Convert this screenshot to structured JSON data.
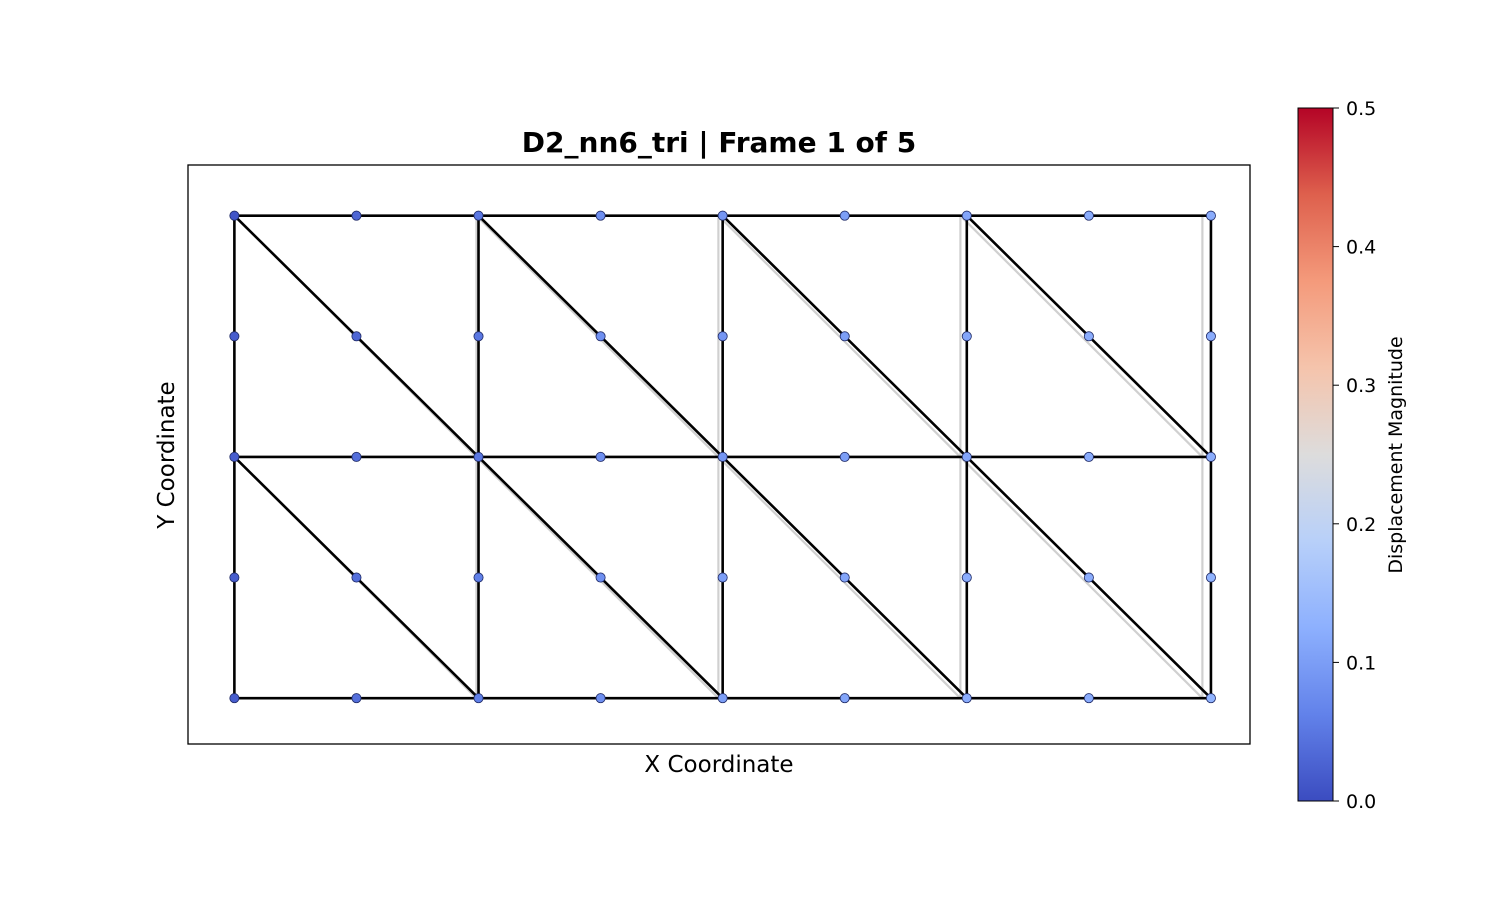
{
  "chart_data": {
    "type": "scatter",
    "title": "D2_nn6_tri  |  Frame 1 of 5",
    "xlabel": "X Coordinate",
    "ylabel": "Y Coordinate",
    "xlim": [
      -0.19,
      4.16
    ],
    "ylim": [
      -0.19,
      2.21
    ],
    "grid": false,
    "colormap": "coolwarm",
    "colorbar": {
      "label": "Displacement Magnitude",
      "range": [
        0.0,
        0.5
      ],
      "ticks": [
        "0.0",
        "0.1",
        "0.2",
        "0.3",
        "0.4",
        "0.5"
      ],
      "stops": [
        "#3b4cc0",
        "#6282ea",
        "#8db0fe",
        "#b8d0f9",
        "#dddcdc",
        "#f5c4ac",
        "#f49a7b",
        "#de604d",
        "#b40426"
      ]
    },
    "mesh": {
      "elements": 16,
      "element_type": "triangle, 6-node",
      "undeformed_edge_color": "#d0d0d0",
      "deformed_edge_color": "#000000",
      "nodes": [
        {
          "x": 0.0,
          "y": 2.0,
          "d": 0.01
        },
        {
          "x": 0.5,
          "y": 2.0,
          "d": 0.03
        },
        {
          "x": 1.0,
          "y": 2.0,
          "d": 0.05
        },
        {
          "x": 1.5,
          "y": 2.0,
          "d": 0.08
        },
        {
          "x": 2.0,
          "y": 2.0,
          "d": 0.09
        },
        {
          "x": 2.5,
          "y": 2.0,
          "d": 0.1
        },
        {
          "x": 3.0,
          "y": 2.0,
          "d": 0.11
        },
        {
          "x": 3.5,
          "y": 2.0,
          "d": 0.12
        },
        {
          "x": 4.0,
          "y": 2.0,
          "d": 0.12
        },
        {
          "x": 0.0,
          "y": 1.5,
          "d": 0.02
        },
        {
          "x": 0.5,
          "y": 1.5,
          "d": 0.03
        },
        {
          "x": 1.0,
          "y": 1.5,
          "d": 0.05
        },
        {
          "x": 1.5,
          "y": 1.5,
          "d": 0.08
        },
        {
          "x": 2.0,
          "y": 1.5,
          "d": 0.09
        },
        {
          "x": 2.5,
          "y": 1.5,
          "d": 0.1
        },
        {
          "x": 3.0,
          "y": 1.5,
          "d": 0.11
        },
        {
          "x": 3.5,
          "y": 1.5,
          "d": 0.12
        },
        {
          "x": 4.0,
          "y": 1.5,
          "d": 0.12
        },
        {
          "x": 0.0,
          "y": 1.0,
          "d": 0.02
        },
        {
          "x": 0.5,
          "y": 1.0,
          "d": 0.04
        },
        {
          "x": 1.0,
          "y": 1.0,
          "d": 0.05
        },
        {
          "x": 1.5,
          "y": 1.0,
          "d": 0.08
        },
        {
          "x": 2.0,
          "y": 1.0,
          "d": 0.09
        },
        {
          "x": 2.5,
          "y": 1.0,
          "d": 0.1
        },
        {
          "x": 3.0,
          "y": 1.0,
          "d": 0.11
        },
        {
          "x": 3.5,
          "y": 1.0,
          "d": 0.12
        },
        {
          "x": 4.0,
          "y": 1.0,
          "d": 0.12
        },
        {
          "x": 0.0,
          "y": 0.5,
          "d": 0.02
        },
        {
          "x": 0.5,
          "y": 0.5,
          "d": 0.04
        },
        {
          "x": 1.0,
          "y": 0.5,
          "d": 0.06
        },
        {
          "x": 1.5,
          "y": 0.5,
          "d": 0.08
        },
        {
          "x": 2.0,
          "y": 0.5,
          "d": 0.1
        },
        {
          "x": 2.5,
          "y": 0.5,
          "d": 0.11
        },
        {
          "x": 3.0,
          "y": 0.5,
          "d": 0.12
        },
        {
          "x": 3.5,
          "y": 0.5,
          "d": 0.12
        },
        {
          "x": 4.0,
          "y": 0.5,
          "d": 0.13
        },
        {
          "x": 0.0,
          "y": 0.0,
          "d": 0.02
        },
        {
          "x": 0.5,
          "y": 0.0,
          "d": 0.04
        },
        {
          "x": 1.0,
          "y": 0.0,
          "d": 0.06
        },
        {
          "x": 1.5,
          "y": 0.0,
          "d": 0.08
        },
        {
          "x": 2.0,
          "y": 0.0,
          "d": 0.1
        },
        {
          "x": 2.5,
          "y": 0.0,
          "d": 0.11
        },
        {
          "x": 3.0,
          "y": 0.0,
          "d": 0.12
        },
        {
          "x": 3.5,
          "y": 0.0,
          "d": 0.12
        },
        {
          "x": 4.0,
          "y": 0.0,
          "d": 0.13
        }
      ]
    }
  }
}
